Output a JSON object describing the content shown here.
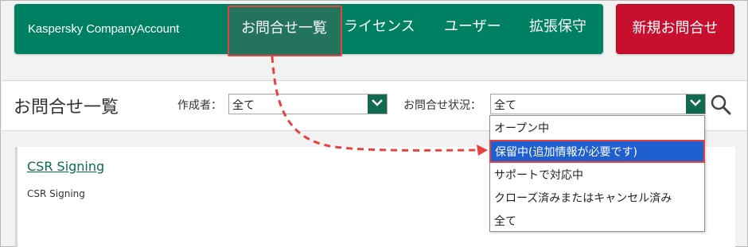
{
  "nav": {
    "brand": "Kaspersky CompanyAccount",
    "items": [
      "お問合せ一覧",
      "ライセンス",
      "ユーザー",
      "拡張保守"
    ],
    "new_button": "新規お問合せ"
  },
  "header": {
    "title": "お問合せ一覧",
    "creator_label": "作成者：",
    "creator_value": "全て",
    "status_label": "お問合せ状況：",
    "status_value": "全て"
  },
  "dropdown": {
    "options": [
      "オープン中",
      "保留中(追加情報が必要です)",
      "サポートで対応中",
      "クローズ済みまたはキャンセル済み",
      "全て"
    ],
    "selected_index": 1
  },
  "card": {
    "title": "CSR Signing",
    "subtitle": "CSR Signing"
  },
  "colors": {
    "nav_green": "#008062",
    "red_button": "#c8102e",
    "highlight": "#e8413f",
    "selected_blue": "#1f5fcf"
  }
}
